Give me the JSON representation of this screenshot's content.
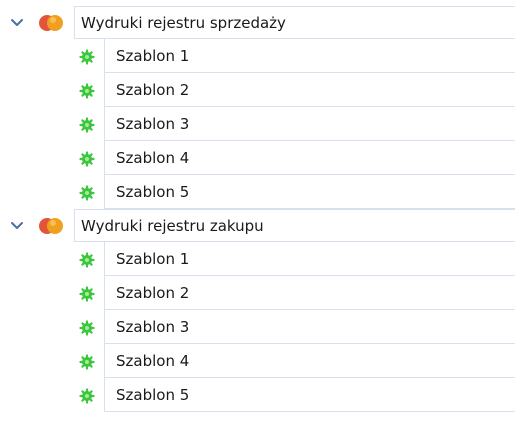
{
  "tree": {
    "groups": [
      {
        "label": "Wydruki rejestru sprzedaży",
        "items": [
          {
            "label": "Szablon 1"
          },
          {
            "label": "Szablon 2"
          },
          {
            "label": "Szablon 3"
          },
          {
            "label": "Szablon 4"
          },
          {
            "label": "Szablon 5"
          }
        ]
      },
      {
        "label": "Wydruki rejestru zakupu",
        "items": [
          {
            "label": "Szablon 1"
          },
          {
            "label": "Szablon 2"
          },
          {
            "label": "Szablon 3"
          },
          {
            "label": "Szablon 4"
          },
          {
            "label": "Szablon 5"
          }
        ]
      }
    ]
  },
  "icons": {
    "expand": "chevron-down-icon",
    "group": "report-group-icon",
    "item": "template-gear-icon"
  },
  "colors": {
    "grid_line": "#d6e0ef",
    "chevron": "#4a6fa5",
    "item_icon": "#3cc63c",
    "group_icon_orange": "#f0a01e",
    "group_icon_red": "#e2553a"
  }
}
